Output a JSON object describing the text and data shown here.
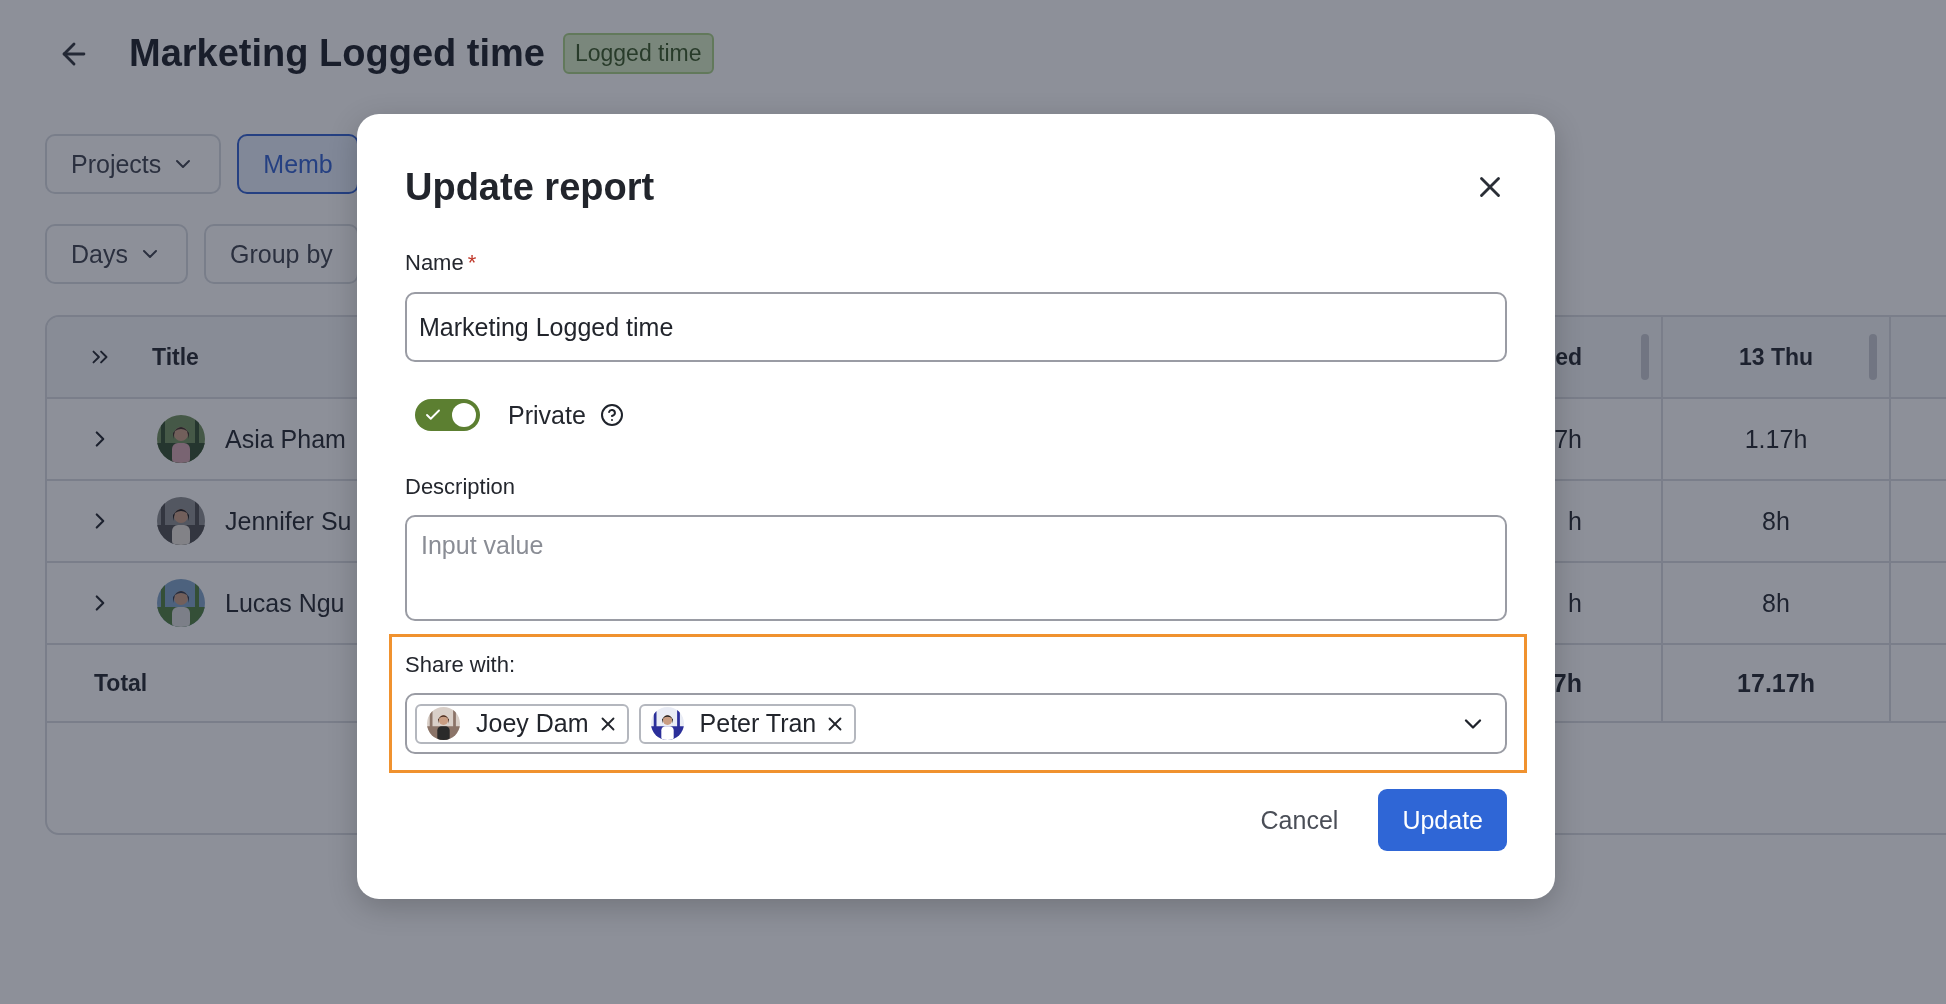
{
  "page": {
    "title": "Marketing Logged time",
    "badge": "Logged time"
  },
  "filters": [
    {
      "items": [
        {
          "label": "Projects",
          "selected": false,
          "caret": true
        },
        {
          "label": "Memb",
          "selected": true,
          "caret": false
        }
      ]
    },
    {
      "items": [
        {
          "label": "Days",
          "selected": false,
          "caret": true
        },
        {
          "label": "Group by",
          "selected": false,
          "caret": false
        }
      ]
    }
  ],
  "table": {
    "columns": [
      {
        "label": "Title"
      },
      {
        "label": "ed"
      },
      {
        "label": "13 Thu"
      }
    ],
    "rows": [
      {
        "cells": [
          "Asia Pham",
          "7h",
          "1.17h"
        ]
      },
      {
        "cells": [
          "Jennifer Su",
          "h",
          "8h"
        ]
      },
      {
        "cells": [
          "Lucas Ngu",
          "h",
          "8h"
        ]
      }
    ],
    "total": {
      "cells": [
        "Total",
        "7h",
        "17.17h"
      ]
    }
  },
  "dialog": {
    "title": "Update report",
    "name": {
      "label": "Name",
      "required_mark": "*",
      "value": "Marketing Logged time"
    },
    "private": {
      "label": "Private",
      "on": true
    },
    "description": {
      "label": "Description",
      "placeholder": "Input value"
    },
    "share": {
      "label": "Share with:",
      "highlighted": true,
      "tags": [
        {
          "name": "Joey Dam"
        },
        {
          "name": "Peter Tran"
        }
      ]
    },
    "buttons": {
      "cancel": "Cancel",
      "submit": "Update"
    }
  }
}
